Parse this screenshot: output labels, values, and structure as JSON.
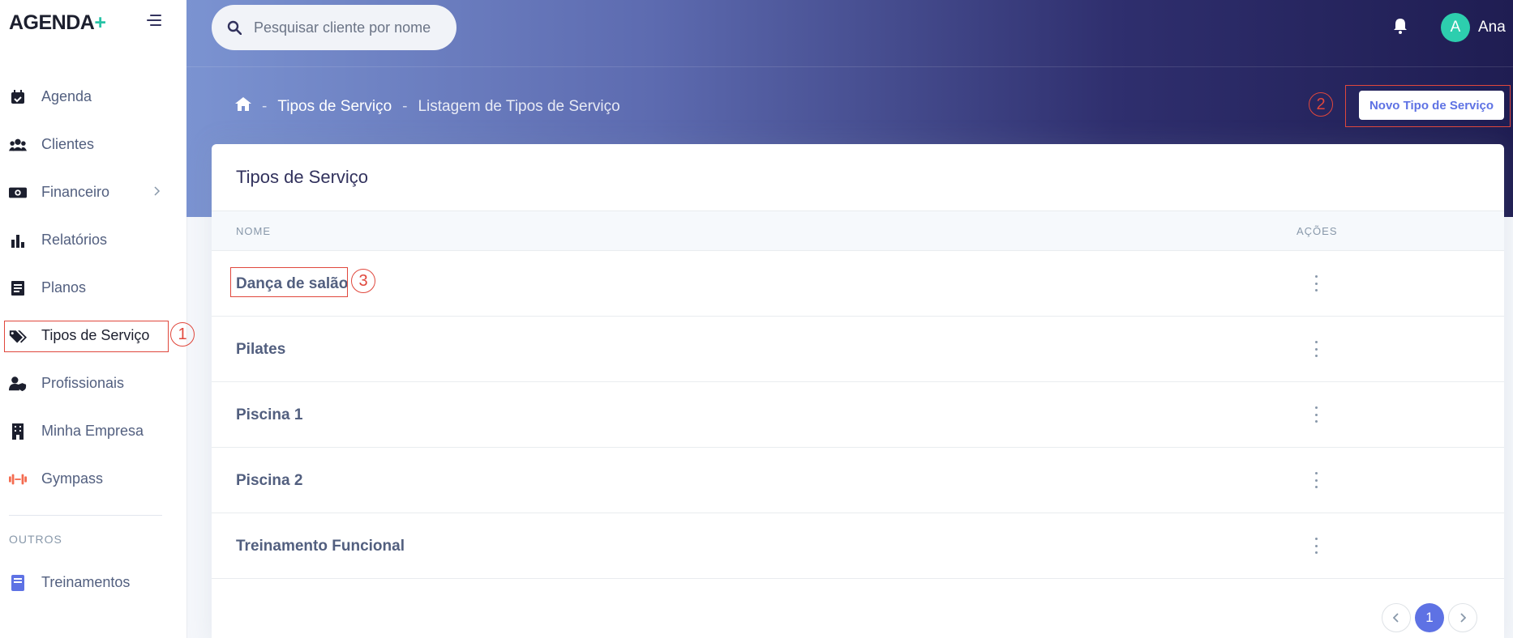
{
  "app": {
    "logo_text": "AGENDA",
    "logo_plus": "+"
  },
  "search": {
    "placeholder": "Pesquisar cliente por nome"
  },
  "user": {
    "initial": "A",
    "name": "Ana"
  },
  "sidebar": {
    "items": [
      {
        "label": "Agenda",
        "icon": "calendar-icon"
      },
      {
        "label": "Clientes",
        "icon": "users-icon"
      },
      {
        "label": "Financeiro",
        "icon": "money-icon"
      },
      {
        "label": "Relatórios",
        "icon": "bar-chart-icon"
      },
      {
        "label": "Planos",
        "icon": "document-icon"
      },
      {
        "label": "Tipos de Serviço",
        "icon": "tags-icon",
        "active": true
      },
      {
        "label": "Profissionais",
        "icon": "user-shield-icon"
      },
      {
        "label": "Minha Empresa",
        "icon": "building-icon"
      },
      {
        "label": "Gympass",
        "icon": "dumbbell-icon"
      }
    ],
    "section_title": "OUTROS",
    "other_items": [
      {
        "label": "Treinamentos",
        "icon": "book-icon"
      }
    ]
  },
  "breadcrumb": {
    "home_icon": "home-icon",
    "section": "Tipos de Serviço",
    "current": "Listagem de Tipos de Serviço",
    "separator": "-"
  },
  "header": {
    "new_button": "Novo Tipo de Serviço"
  },
  "card": {
    "title": "Tipos de Serviço",
    "columns": {
      "name": "NOME",
      "actions": "AÇÕES"
    },
    "rows": [
      {
        "name": "Dança de salão"
      },
      {
        "name": "Pilates"
      },
      {
        "name": "Piscina 1"
      },
      {
        "name": "Piscina 2"
      },
      {
        "name": "Treinamento Funcional"
      }
    ]
  },
  "pagination": {
    "current_page": "1"
  },
  "annotations": {
    "a1": "1",
    "a2": "2",
    "a3": "3"
  },
  "colors": {
    "accent": "#5e72e4",
    "annotation": "#e0473c",
    "avatar": "#2dceae"
  }
}
